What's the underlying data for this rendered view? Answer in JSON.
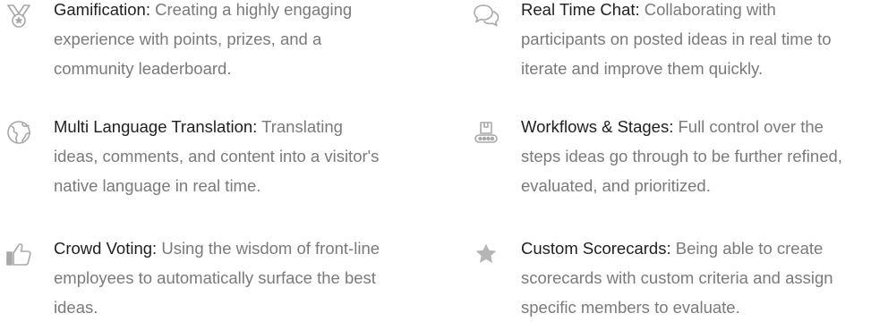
{
  "features": [
    {
      "icon": "medal-icon",
      "title": "Gamification:",
      "description": "Creating a highly engaging experience with points, prizes, and a community leaderboard."
    },
    {
      "icon": "chat-bubbles-icon",
      "title": "Real Time Chat:",
      "description": "Collaborating with participants on posted ideas in real time to iterate and improve them quickly."
    },
    {
      "icon": "globe-icon",
      "title": "Multi Language Translation:",
      "description": "Translating ideas, comments, and content into a visitor's native language in real time."
    },
    {
      "icon": "conveyor-icon",
      "title": "Workflows & Stages:",
      "description": "Full control over the steps ideas go through to be further refined, evaluated, and prioritized."
    },
    {
      "icon": "thumbs-up-icon",
      "title": "Crowd Voting:",
      "description": "Using the wisdom of front-line employees to automatically surface the best ideas."
    },
    {
      "icon": "star-icon",
      "title": "Custom Scorecards:",
      "description": "Being able to create scorecards with custom criteria and assign specific members to evaluate."
    }
  ],
  "colors": {
    "icon": "#a8a8a8",
    "title": "#1f1f1f",
    "body": "#7a7a7a"
  }
}
